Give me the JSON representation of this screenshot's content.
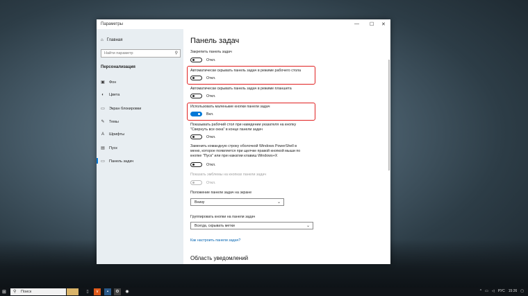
{
  "window": {
    "title": "Параметры",
    "controls": {
      "minimize": "—",
      "maximize": "☐",
      "close": "✕"
    }
  },
  "sidebar": {
    "home_label": "Главная",
    "search_placeholder": "Найти параметр",
    "section_title": "Персонализация",
    "items": [
      {
        "label": "Фон",
        "icon": "image-icon",
        "glyph": "▣"
      },
      {
        "label": "Цвета",
        "icon": "palette-icon",
        "glyph": "◐"
      },
      {
        "label": "Экран блокировки",
        "icon": "lock-screen-icon",
        "glyph": "▭"
      },
      {
        "label": "Темы",
        "icon": "brush-icon",
        "glyph": "✎"
      },
      {
        "label": "Шрифты",
        "icon": "font-icon",
        "glyph": "A"
      },
      {
        "label": "Пуск",
        "icon": "start-icon",
        "glyph": "▤"
      },
      {
        "label": "Панель задач",
        "icon": "taskbar-icon",
        "glyph": "▭",
        "active": true
      }
    ]
  },
  "main": {
    "title": "Панель задач",
    "settings": [
      {
        "label": "Закрепить панель задач",
        "state": "Откл."
      },
      {
        "label": "Автоматически скрывать панель задач в режиме рабочего стола",
        "state": "Откл."
      },
      {
        "label": "Автоматически скрывать панель задач в режиме планшета",
        "state": "Откл."
      },
      {
        "label": "Использовать маленькие кнопки панели задач",
        "state": "Вкл."
      },
      {
        "label_line1": "Показывать рабочий стол при наведении указателя на кнопку",
        "label_line2": "\"Свернуть все окна\" в конце панели задач",
        "state": "Откл."
      },
      {
        "label_line1": "Заменить командную строку оболочкой Windows PowerShell в",
        "label_line2": "меню, которое появляется при щелчке правой кнопкой мыши по",
        "label_line3": "кнопке \"Пуск\" или при нажатии клавиш Windows+X",
        "state": "Откл."
      },
      {
        "label": "Показать эмблемы на кнопках панели задач",
        "state": "Откл."
      }
    ],
    "position_label": "Положение панели задач на экране",
    "position_value": "Внизу",
    "group_label": "Группировать кнопки на панели задач",
    "group_value": "Всегда, скрывать метки",
    "help_link": "Как настроить панели задач?",
    "notification_area": "Область уведомлений"
  },
  "taskbar": {
    "search_placeholder": "Поиск",
    "tray_lang": "РУС",
    "tray_time": "15:26"
  },
  "colors": {
    "accent": "#0078d7",
    "highlight": "#e02020"
  }
}
